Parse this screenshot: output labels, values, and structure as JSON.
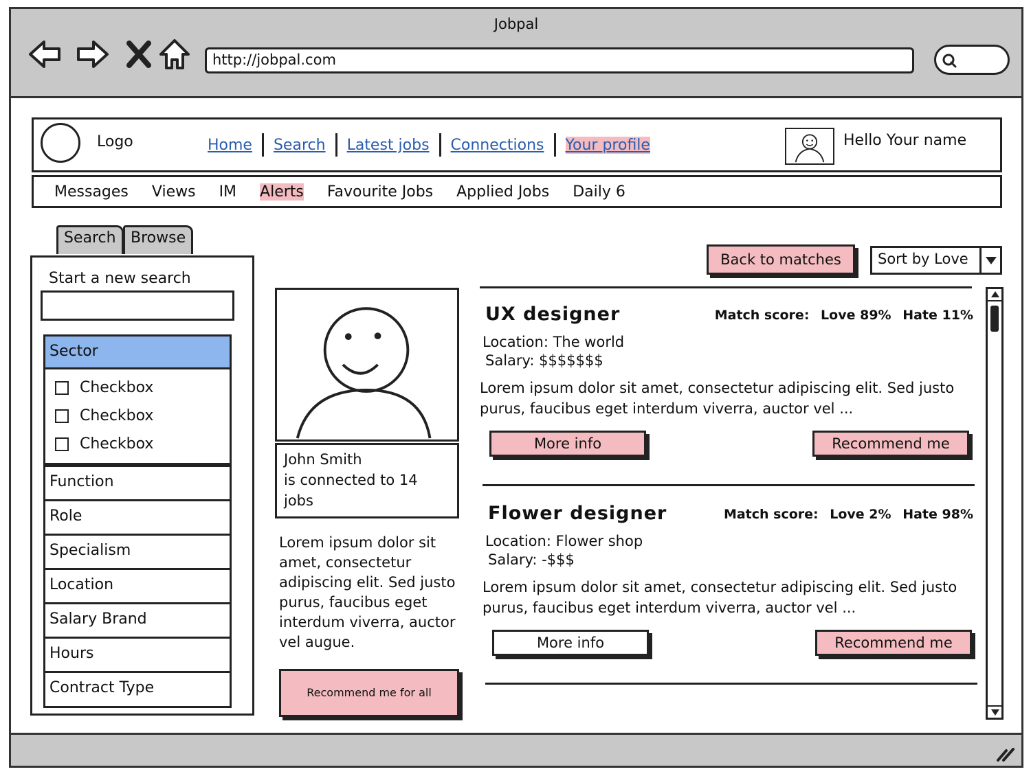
{
  "window": {
    "title": "Jobpal",
    "url": "http://jobpal.com"
  },
  "header": {
    "logo_label": "Logo",
    "nav": [
      "Home",
      "Search",
      "Latest jobs",
      "Connections",
      "Your profile"
    ],
    "greeting": "Hello Your name"
  },
  "subnav": [
    "Messages",
    "Views",
    "IM",
    "Alerts",
    "Favourite Jobs",
    "Applied Jobs",
    "Daily 6"
  ],
  "sidebar": {
    "tabs": [
      "Search",
      "Browse"
    ],
    "new_search_label": "Start a new search",
    "search_value": "",
    "sections": [
      "Sector",
      "Function",
      "Role",
      "Specialism",
      "Location",
      "Salary Brand",
      "Hours",
      "Contract Type"
    ],
    "checkboxes": [
      "Checkbox",
      "Checkbox",
      "Checkbox"
    ]
  },
  "profile": {
    "name": "John Smith",
    "connected": "is connected to 14",
    "connected_suffix": "jobs",
    "text": "Lorem ipsum dolor sit amet, consectetur adipiscing elit. Sed justo purus, faucibus eget interdum viverra, auctor vel augue.",
    "recommend_all": "Recommend me for all"
  },
  "controls": {
    "back": "Back to matches",
    "sort": "Sort by Love"
  },
  "jobs": [
    {
      "title": "UX designer",
      "match_label": "Match score:",
      "love": "Love 89%",
      "hate": "Hate 11%",
      "location": "Location: The world",
      "salary": "Salary: $$$$$$$",
      "description": "Lorem ipsum dolor sit amet, consectetur adipiscing elit. Sed justo purus, faucibus eget interdum viverra, auctor vel ...",
      "more": "More info",
      "recommend": "Recommend me"
    },
    {
      "title": "Flower designer",
      "match_label": "Match score:",
      "love": "Love 2%",
      "hate": "Hate 98%",
      "location": "Location: Flower shop",
      "salary": "Salary: -$$$",
      "description": "Lorem ipsum dolor sit amet, consectetur adipiscing elit. Sed justo purus, faucibus eget interdum viverra, auctor vel ...",
      "more": "More info",
      "recommend": "Recommend me"
    }
  ],
  "colors": {
    "highlight": "#f4bcc0",
    "selected": "#8db5ee",
    "chrome": "#c8c8c8"
  }
}
